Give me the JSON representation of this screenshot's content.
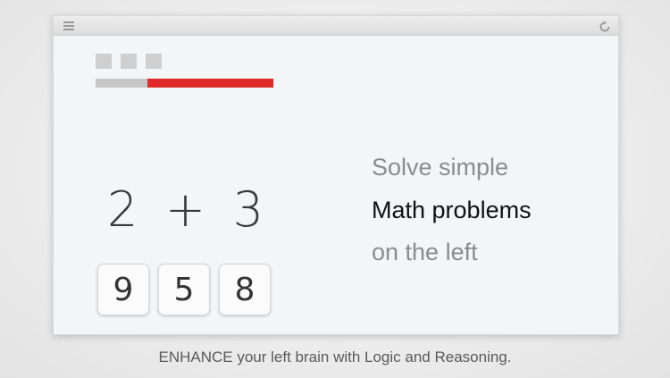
{
  "toolbar": {
    "menu_icon": "menu-icon",
    "refresh_icon": "refresh-icon"
  },
  "progress": {
    "squares_count": 3,
    "time_remaining_fraction": 0.71,
    "fill_color": "#e02a2a"
  },
  "problem": {
    "left": "2",
    "operator": "+",
    "right": "3"
  },
  "answers": [
    "9",
    "5",
    "8"
  ],
  "hint": {
    "line1": "Solve simple",
    "line2": "Math problems",
    "line3": "on the left"
  },
  "caption": "ENHANCE your left brain with Logic and Reasoning."
}
